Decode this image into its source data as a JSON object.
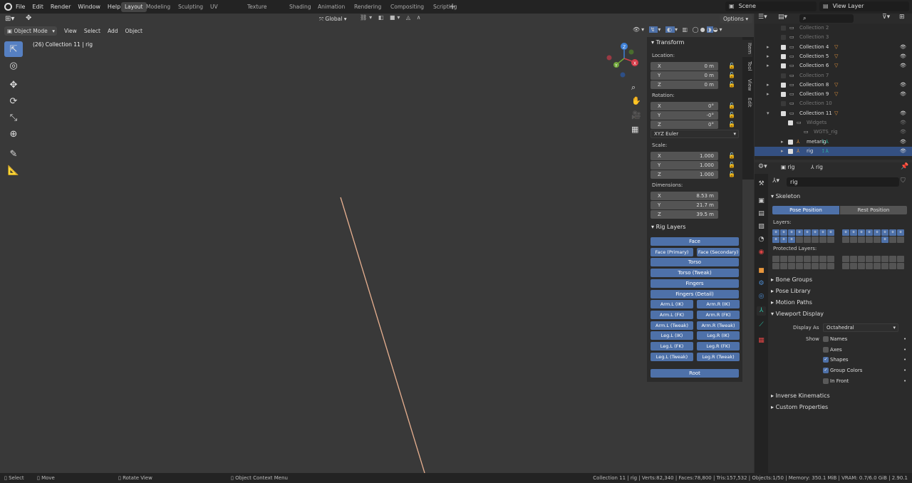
{
  "topbar": {
    "menus": [
      "File",
      "Edit",
      "Render",
      "Window",
      "Help"
    ],
    "workspaces": [
      "Layout",
      "Modeling",
      "Sculpting",
      "UV Editing",
      "Texture Paint",
      "Shading",
      "Animation",
      "Rendering",
      "Compositing",
      "Scripting"
    ],
    "active_workspace": "Layout",
    "add_tab": "+",
    "scene": "Scene",
    "view_layer": "View Layer"
  },
  "viewport": {
    "mode": "Object Mode",
    "menus": [
      "View",
      "Select",
      "Add",
      "Object"
    ],
    "orientation": "Global",
    "options": "Options",
    "info": "(26) Collection 11 | rig"
  },
  "npanel": {
    "tabs": [
      "Item",
      "Tool",
      "View",
      "Edit"
    ],
    "transform_title": "Transform",
    "location_label": "Location:",
    "location": [
      {
        "k": "X",
        "v": "0 m"
      },
      {
        "k": "Y",
        "v": "0 m"
      },
      {
        "k": "Z",
        "v": "0 m"
      }
    ],
    "rotation_label": "Rotation:",
    "rotation": [
      {
        "k": "X",
        "v": "0°"
      },
      {
        "k": "Y",
        "v": "-0°"
      },
      {
        "k": "Z",
        "v": "0°"
      }
    ],
    "rotation_mode": "XYZ Euler",
    "scale_label": "Scale:",
    "scale": [
      {
        "k": "X",
        "v": "1.000"
      },
      {
        "k": "Y",
        "v": "1.000"
      },
      {
        "k": "Z",
        "v": "1.000"
      }
    ],
    "dimensions_label": "Dimensions:",
    "dimensions": [
      {
        "k": "X",
        "v": "8.53 m"
      },
      {
        "k": "Y",
        "v": "21.7 m"
      },
      {
        "k": "Z",
        "v": "39.5 m"
      }
    ],
    "rig_layers_title": "Rig Layers",
    "rig_buttons": [
      [
        "Face"
      ],
      [
        "Face (Primary)",
        "Face (Secondary)"
      ],
      [
        "Torso"
      ],
      [
        "Torso (Tweak)"
      ],
      [
        "Fingers"
      ],
      [
        "Fingers (Detail)"
      ],
      [
        "Arm.L (IK)",
        "Arm.R (IK)"
      ],
      [
        "Arm.L (FK)",
        "Arm.R (FK)"
      ],
      [
        "Arm.L (Tweak)",
        "Arm.R (Tweak)"
      ],
      [
        "Leg.L (IK)",
        "Leg.R (IK)"
      ],
      [
        "Leg.L (FK)",
        "Leg.R (FK)"
      ],
      [
        "Leg.L (Tweak)",
        "Leg.R (Tweak)"
      ]
    ],
    "root_button": "Root"
  },
  "outliner": {
    "rows": [
      {
        "name": "Collection 2",
        "dim": true,
        "sel": false,
        "indent": 0
      },
      {
        "name": "Collection 3",
        "dim": true,
        "sel": false,
        "indent": 0
      },
      {
        "name": "Collection 4",
        "dim": false,
        "sel": false,
        "indent": 0
      },
      {
        "name": "Collection 5",
        "dim": false,
        "sel": false,
        "indent": 0
      },
      {
        "name": "Collection 6",
        "dim": false,
        "sel": false,
        "indent": 0
      },
      {
        "name": "Collection 7",
        "dim": true,
        "sel": false,
        "indent": 0
      },
      {
        "name": "Collection 8",
        "dim": false,
        "sel": false,
        "indent": 0
      },
      {
        "name": "Collection 9",
        "dim": false,
        "sel": false,
        "indent": 0
      },
      {
        "name": "Collection 10",
        "dim": true,
        "sel": false,
        "indent": 0
      },
      {
        "name": "Collection 11",
        "dim": false,
        "sel": false,
        "indent": 0
      },
      {
        "name": "Widgets",
        "dim": true,
        "sel": false,
        "indent": 1
      },
      {
        "name": "WGTS_rig",
        "dim": true,
        "sel": false,
        "indent": 2
      },
      {
        "name": "metarig",
        "dim": false,
        "sel": false,
        "indent": 1
      },
      {
        "name": "rig",
        "dim": false,
        "sel": true,
        "indent": 1
      }
    ]
  },
  "properties": {
    "crumb_obj": "rig",
    "crumb_data": "rig",
    "name_field": "rig",
    "skeleton": "Skeleton",
    "pose_position": "Pose Position",
    "rest_position": "Rest Position",
    "layers_label": "Layers:",
    "protected_label": "Protected Layers:",
    "collapsed_sections": [
      "Bone Groups",
      "Pose Library",
      "Motion Paths"
    ],
    "viewport_display": "Viewport Display",
    "display_as_label": "Display As",
    "display_as": "Octahedral",
    "show_label": "Show",
    "show_options": [
      {
        "label": "Names",
        "on": false
      },
      {
        "label": "Axes",
        "on": false
      },
      {
        "label": "Shapes",
        "on": true
      },
      {
        "label": "Group Colors",
        "on": true
      },
      {
        "label": "In Front",
        "on": false
      }
    ],
    "bottom_sections": [
      "Inverse Kinematics",
      "Custom Properties"
    ]
  },
  "status": {
    "select": "Select",
    "move": "Move",
    "rotate": "Rotate View",
    "context": "Object Context Menu",
    "stats": "Collection 11 | rig | Verts:82,340 | Faces:78,800 | Tris:157,532 | Objects:1/50 | Memory: 350.1 MiB | VRAM: 0.7/6.0 GiB | 2.90.1"
  }
}
